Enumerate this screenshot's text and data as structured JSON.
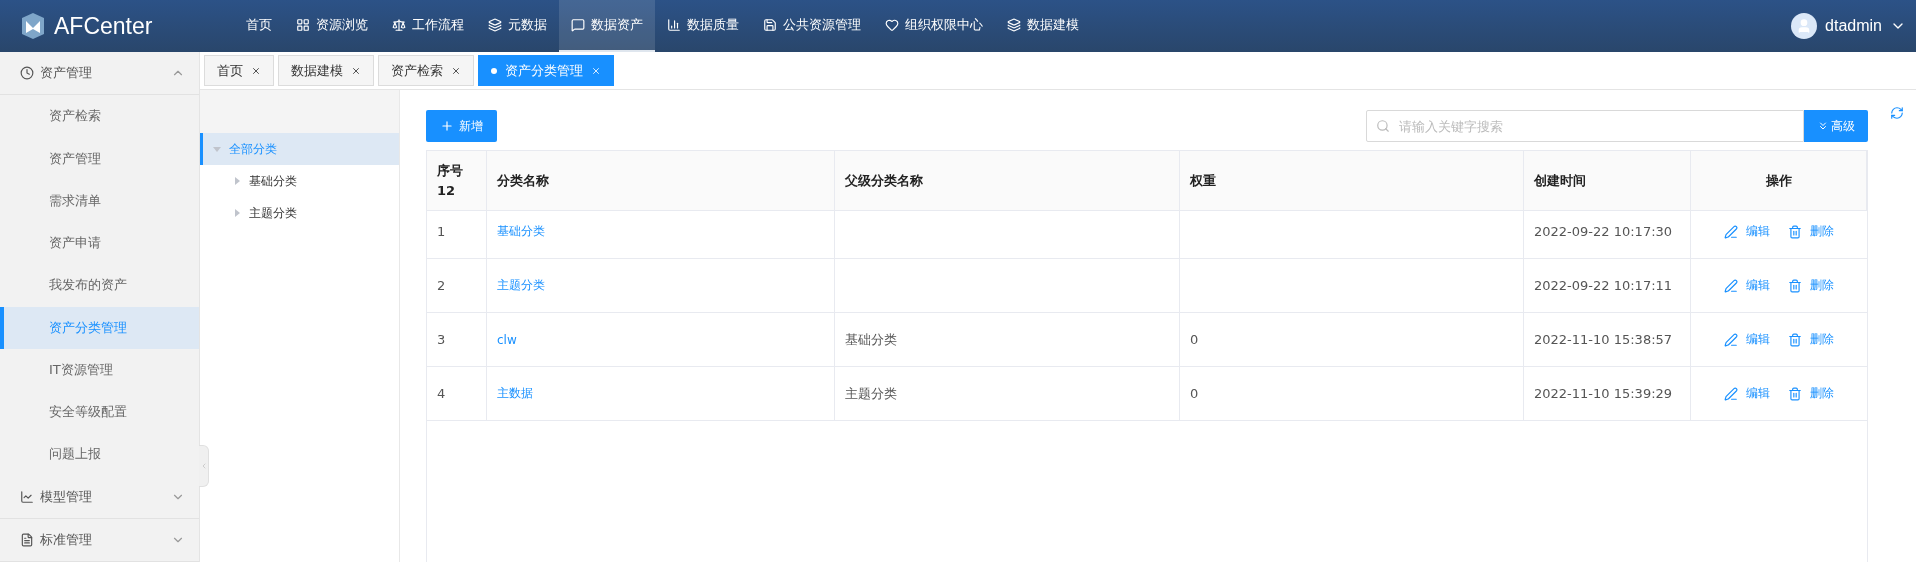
{
  "header": {
    "logo": "AFCenter",
    "nav": [
      {
        "label": "首页",
        "selected": false
      },
      {
        "label": "资源浏览",
        "selected": false
      },
      {
        "label": "工作流程",
        "selected": false
      },
      {
        "label": "元数据",
        "selected": false
      },
      {
        "label": "数据资产",
        "selected": true
      },
      {
        "label": "数据质量",
        "selected": false
      },
      {
        "label": "公共资源管理",
        "selected": false
      },
      {
        "label": "组织权限中心",
        "selected": false
      },
      {
        "label": "数据建模",
        "selected": false
      }
    ],
    "user": "dtadmin"
  },
  "sidebar": {
    "groups": [
      {
        "label": "资产管理",
        "expanded": true,
        "items": [
          {
            "label": "资产检索",
            "selected": false
          },
          {
            "label": "资产管理",
            "selected": false
          },
          {
            "label": "需求清单",
            "selected": false
          },
          {
            "label": "资产申请",
            "selected": false
          },
          {
            "label": "我发布的资产",
            "selected": false
          },
          {
            "label": "资产分类管理",
            "selected": true
          },
          {
            "label": "IT资源管理",
            "selected": false
          },
          {
            "label": "安全等级配置",
            "selected": false
          },
          {
            "label": "问题上报",
            "selected": false
          }
        ]
      },
      {
        "label": "模型管理",
        "expanded": false
      },
      {
        "label": "标准管理",
        "expanded": false
      }
    ]
  },
  "tabs": [
    {
      "label": "首页",
      "selected": false
    },
    {
      "label": "数据建模",
      "selected": false
    },
    {
      "label": "资产检索",
      "selected": false
    },
    {
      "label": "资产分类管理",
      "selected": true
    }
  ],
  "tree": [
    {
      "label": "全部分类",
      "expanded": true,
      "selected": true,
      "children": [
        {
          "label": "基础分类",
          "expanded": false,
          "selected": false
        },
        {
          "label": "主题分类",
          "expanded": false,
          "selected": false
        }
      ]
    }
  ],
  "toolbar": {
    "add_button": "新增",
    "search": {
      "placeholder": "请输入关键字搜索"
    },
    "advanced_button": "高级"
  },
  "table": {
    "columns": [
      "序号",
      "分类名称",
      "父级分类名称",
      "权重",
      "创建时间",
      "操作"
    ],
    "count": "12",
    "rows": [
      {
        "index": "1",
        "name": "基础分类",
        "parent": "",
        "weight": "",
        "created": "2022-09-22 10:17:30",
        "edit": "编辑",
        "delete": "删除"
      },
      {
        "index": "2",
        "name": "主题分类",
        "parent": "",
        "weight": "",
        "created": "2022-09-22 10:17:11",
        "edit": "编辑",
        "delete": "删除"
      },
      {
        "index": "3",
        "name": "clw",
        "parent": "基础分类",
        "weight": "0",
        "created": "2022-11-10 15:38:57",
        "edit": "编辑",
        "delete": "删除"
      },
      {
        "index": "4",
        "name": "主数据",
        "parent": "主题分类",
        "weight": "0",
        "created": "2022-11-10 15:39:29",
        "edit": "编辑",
        "delete": "删除"
      }
    ]
  }
}
